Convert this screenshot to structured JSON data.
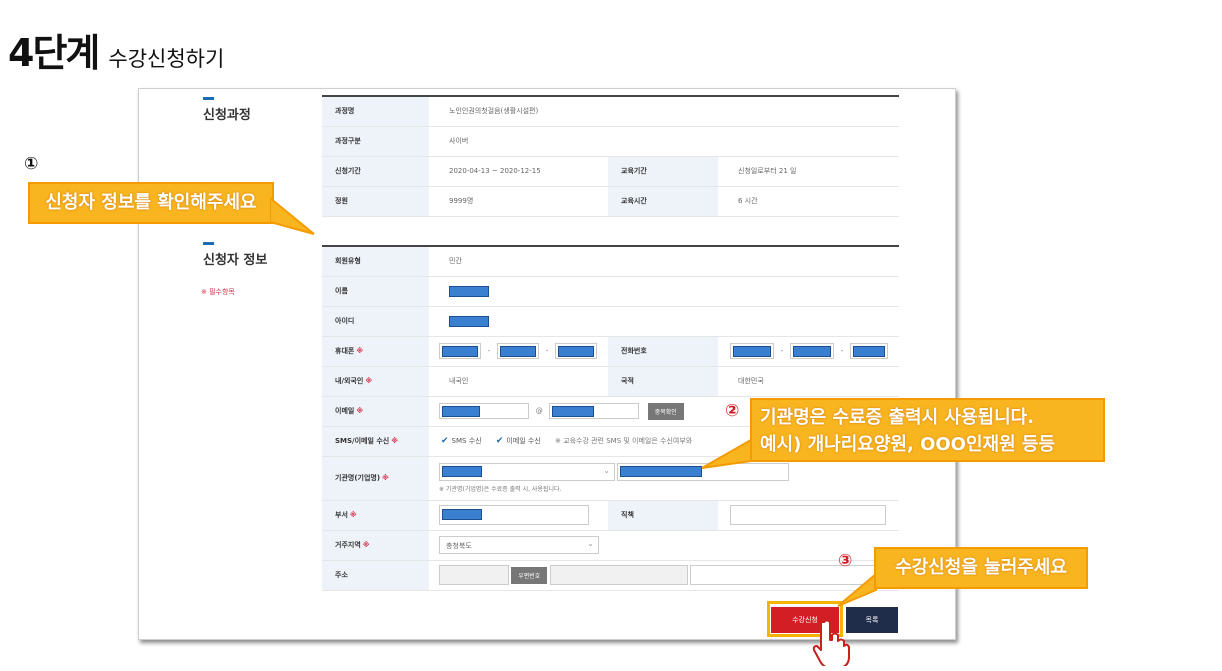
{
  "header": {
    "step": "4단계",
    "subtitle": "수강신청하기"
  },
  "course": {
    "section_title": "신청과정",
    "rows": {
      "name_label": "과정명",
      "name_value": "노인인권의첫걸음(생활시설편)",
      "type_label": "과정구분",
      "type_value": "사이버",
      "period_label": "신청기간",
      "period_value": "2020-04-13 ~ 2020-12-15",
      "edu_period_label": "교육기간",
      "edu_period_value": "신청일로부터 21 일",
      "capacity_label": "정원",
      "capacity_value": "9999명",
      "edu_hours_label": "교육시간",
      "edu_hours_value": "6 시간"
    }
  },
  "applicant": {
    "section_title": "신청자 정보",
    "required_note": "※ 필수항목",
    "member_type_label": "회원유형",
    "member_type_value": "민간",
    "name_label": "이름",
    "id_label": "아이디",
    "mobile_label": "휴대폰",
    "phone_label": "전화번호",
    "nationality_label": "내/외국인",
    "nationality_value": "내국인",
    "country_label": "국적",
    "country_value": "대한민국",
    "email_label": "이메일",
    "email_at": "@",
    "dup_check": "중복확인",
    "sms_label": "SMS/이메일 수신",
    "sms_option": "SMS 수신",
    "email_option": "이메일 수신",
    "sms_hint": "※ 교육수강 관련 SMS 및 이메일은 수신여부와",
    "org_label": "기관명(기업명)",
    "org_note": "※ 기관명(기업명)은 수료증 출력 시, 사용됩니다.",
    "dept_label": "부서",
    "position_label": "직책",
    "region_label": "거주지역",
    "region_value": "충청북도",
    "address_label": "주소",
    "zip_button": "우편번호",
    "required_mark": "※"
  },
  "buttons": {
    "apply": "수강신청",
    "list": "목록"
  },
  "callouts": {
    "c1_num": "①",
    "c1_text": "신청자 정보를 확인해주세요",
    "c2_num": "②",
    "c2_line1": "기관명은 수료증 출력시 사용됩니다.",
    "c2_line2": "예시) 개나리요양원, OOO인재원 등등",
    "c3_num": "③",
    "c3_text": "수강신청을 눌러주세요"
  },
  "colors": {
    "accent": "#f9b51f",
    "apply": "#d41e26",
    "list": "#1f2d4a",
    "mask": "#3b7fd0"
  }
}
